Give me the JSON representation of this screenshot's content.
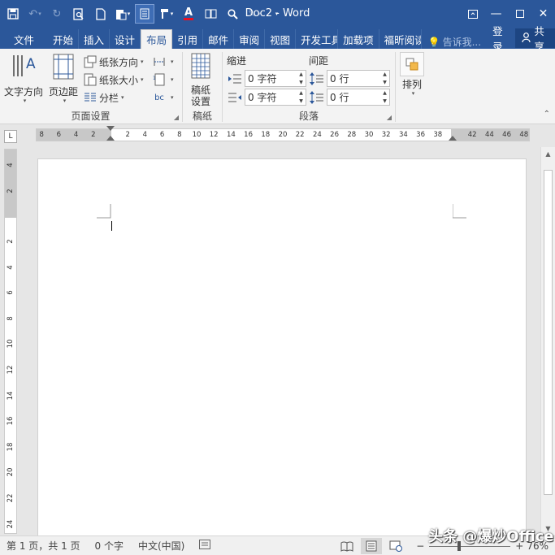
{
  "window": {
    "title": "Doc2 - Word"
  },
  "qat": {
    "icons": [
      "save-icon",
      "undo-icon",
      "redo-icon",
      "print-preview-icon",
      "new-doc-icon",
      "paste-icon",
      "touch-mode-icon",
      "format-painter-icon",
      "font-color-icon",
      "column-view-icon",
      "find-icon",
      "pen-icon",
      "customize-icon"
    ]
  },
  "tabs": [
    {
      "label": "文件"
    },
    {
      "label": "开始"
    },
    {
      "label": "插入"
    },
    {
      "label": "设计"
    },
    {
      "label": "布局"
    },
    {
      "label": "引用"
    },
    {
      "label": "邮件"
    },
    {
      "label": "审阅"
    },
    {
      "label": "视图"
    },
    {
      "label": "开发工具"
    },
    {
      "label": "加载项"
    },
    {
      "label": "福昕阅读"
    }
  ],
  "tell_me": "告诉我...",
  "login": "登录",
  "share": "共享",
  "ribbon": {
    "page_setup": {
      "label": "页面设置",
      "text_direction": "文字方向",
      "margins": "页边距",
      "orientation": "纸张方向",
      "size": "纸张大小",
      "columns": "分栏"
    },
    "manuscript": {
      "label": "稿纸",
      "button": "稿纸\n设置",
      "button_line1": "稿纸",
      "button_line2": "设置"
    },
    "paragraph": {
      "label": "段落",
      "indent_label": "缩进",
      "spacing_label": "间距",
      "indent_left": "0 字符",
      "indent_right": "0 字符",
      "spacing_before": "0 行",
      "spacing_after": "0 行"
    },
    "arrange": {
      "label": "排列"
    }
  },
  "ruler": {
    "h_ticks_left": [
      "8",
      "6",
      "4",
      "2"
    ],
    "h_ticks_main": [
      "2",
      "4",
      "6",
      "8",
      "10",
      "12",
      "14",
      "16",
      "18",
      "20",
      "22",
      "24",
      "26",
      "28",
      "30",
      "32",
      "34",
      "36",
      "38"
    ],
    "h_ticks_right": [
      "42",
      "44",
      "46",
      "48"
    ],
    "v_ticks_top": [
      "4",
      "2"
    ],
    "v_ticks_main": [
      "2",
      "4",
      "6",
      "8",
      "10",
      "12",
      "14",
      "16",
      "18",
      "20",
      "22",
      "24"
    ],
    "corner": "L"
  },
  "status": {
    "page": "第 1 页，共 1 页",
    "words": "0 个字",
    "language": "中文(中国)",
    "zoom": "76%",
    "zoom_level": 0.76
  },
  "watermark": "头条 @爆炒Office",
  "colors": {
    "accent": "#2b579a",
    "ribbon_bg": "#f3f3f3",
    "workspace": "#e6e6e6"
  }
}
